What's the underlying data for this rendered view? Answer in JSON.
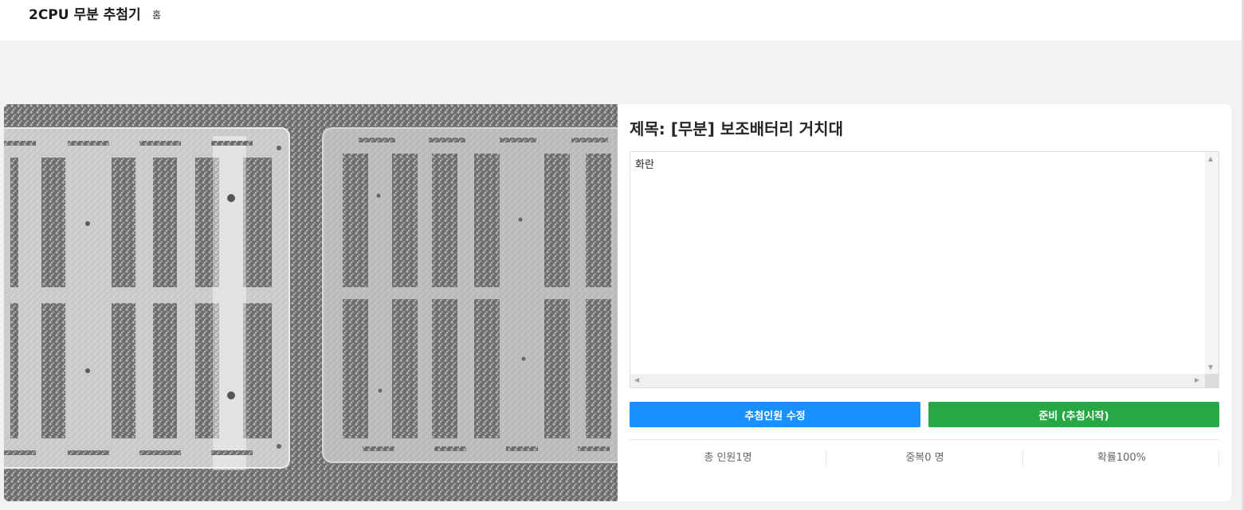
{
  "header": {
    "brand": "2CPU 무분 추첨기",
    "home_link": "홈"
  },
  "post": {
    "title": "제목: [무분] 보조배터리 거치대",
    "content": "화란",
    "image_alt": "보조배터리 거치대 아크릴 패널 사진"
  },
  "actions": {
    "edit_participants": "추첨인원 수정",
    "ready_start": "준비 (추첨시작)"
  },
  "stats": {
    "total": "총 인원1명",
    "duplicate": "중복0 명",
    "probability": "확률100%"
  },
  "colors": {
    "edit_button": "#1890ff",
    "start_button": "#28a745",
    "page_background": "#f2f2f2"
  }
}
